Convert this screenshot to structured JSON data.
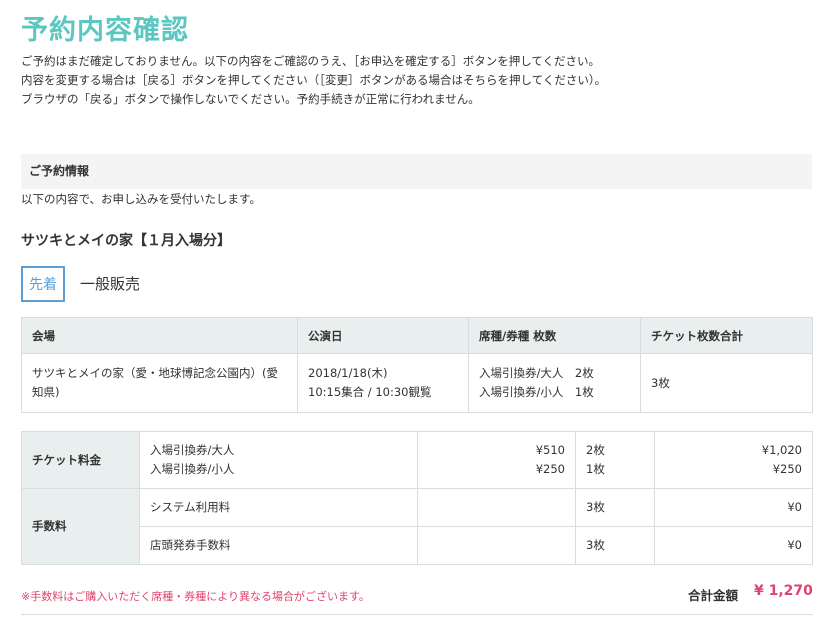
{
  "page": {
    "title": "予約内容確認",
    "intro": [
      "ご予約はまだ確定しておりません。以下の内容をご確認のうえ、［お申込を確定する］ボタンを押してください。",
      "内容を変更する場合は［戻る］ボタンを押してください（［変更］ボタンがある場合はそちらを押してください）。",
      "ブラウザの「戻る」ボタンで操作しないでください。予約手続きが正常に行われません。"
    ]
  },
  "reservation": {
    "section_title": "ご予約情報",
    "section_sub": "以下の内容で、お申し込みを受付いたします。",
    "event_title": "サツキとメイの家【１月入場分】",
    "badge_first": "先着",
    "badge_general": "一般販売"
  },
  "info_table": {
    "headers": [
      "会場",
      "公演日",
      "席種/券種 枚数",
      "チケット枚数合計"
    ],
    "venue": [
      "サツキとメイの家（愛・地球博記念公園内）(愛",
      "知県)"
    ],
    "date": [
      "2018/1/18(木)",
      "10:15集合 / 10:30観覧"
    ],
    "tickets": [
      "入場引換券/大人　2枚",
      "入場引換券/小人　1枚"
    ],
    "total_count": "3枚"
  },
  "price_table": {
    "ticket_label": "チケット料金",
    "ticket_items": [
      "入場引換券/大人",
      "入場引換券/小人"
    ],
    "ticket_unit_prices": [
      "¥510",
      "¥250"
    ],
    "ticket_qty": [
      "2枚",
      "1枚"
    ],
    "ticket_subtotals": [
      "¥1,020",
      "¥250"
    ],
    "fee_label": "手数料",
    "fees": [
      {
        "name": "システム利用料",
        "qty": "3枚",
        "amount": "¥0"
      },
      {
        "name": "店頭発券手数料",
        "qty": "3枚",
        "amount": "¥0"
      }
    ]
  },
  "summary": {
    "fee_note": "※手数料はご購入いただく席種・券種により異なる場合がございます。",
    "total_label": "合計金額",
    "total_value": "¥ 1,270"
  },
  "colors": {
    "title": "#5cc7c0",
    "accent_blue": "#5b9fd6",
    "pink": "#e0436e",
    "table_header_bg": "#e9efee"
  }
}
